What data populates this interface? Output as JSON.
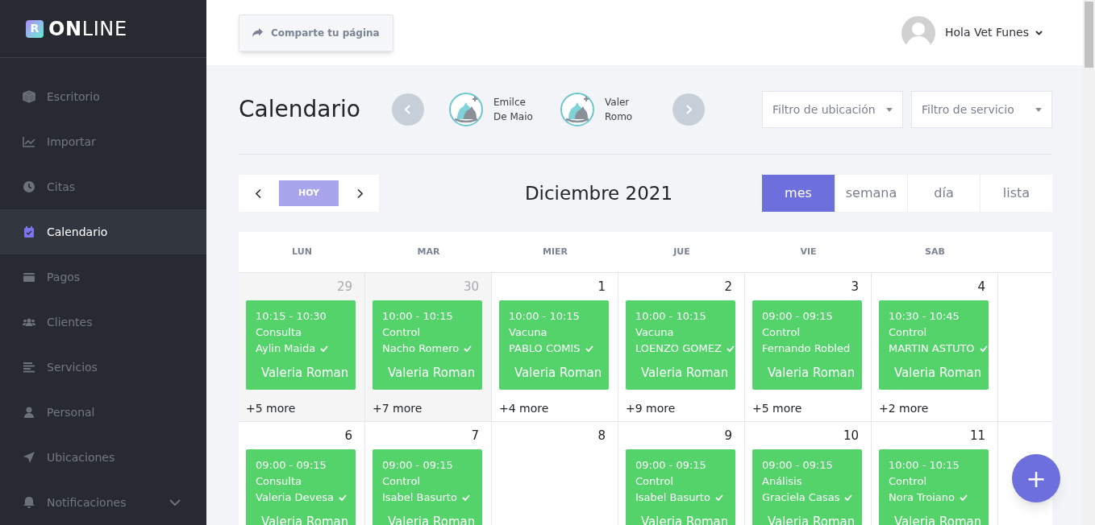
{
  "brand": {
    "mark": "R",
    "bold": "ON",
    "light": "LINE"
  },
  "sidebar": {
    "items": [
      {
        "label": "Escritorio",
        "selected": false,
        "expandable": false
      },
      {
        "label": "Importar",
        "selected": false,
        "expandable": false
      },
      {
        "label": "Citas",
        "selected": false,
        "expandable": false
      },
      {
        "label": "Calendario",
        "selected": true,
        "expandable": false
      },
      {
        "label": "Pagos",
        "selected": false,
        "expandable": false
      },
      {
        "label": "Clientes",
        "selected": false,
        "expandable": false
      },
      {
        "label": "Servicios",
        "selected": false,
        "expandable": false
      },
      {
        "label": "Personal",
        "selected": false,
        "expandable": false
      },
      {
        "label": "Ubicaciones",
        "selected": false,
        "expandable": false
      },
      {
        "label": "Notificaciones",
        "selected": false,
        "expandable": true
      }
    ]
  },
  "topbar": {
    "share_button": "Comparte tu página",
    "user": "Hola Vet Funes"
  },
  "page_title": "Calendario",
  "staff": [
    {
      "name": "Emilce De Maio"
    },
    {
      "name": "Valer Romo"
    }
  ],
  "filters": [
    {
      "placeholder": "Filtro de ubicación"
    },
    {
      "placeholder": "Filtro de servicio"
    }
  ],
  "toolbar": {
    "today": "HOY",
    "title": "Diciembre 2021",
    "views": [
      {
        "label": "mes",
        "selected": true
      },
      {
        "label": "semana",
        "selected": false
      },
      {
        "label": "día",
        "selected": false
      },
      {
        "label": "lista",
        "selected": false
      }
    ]
  },
  "calendar": {
    "weekdays": [
      "LUN",
      "MAR",
      "MIER",
      "JUE",
      "VIE",
      "SAB"
    ],
    "weeks": [
      [
        {
          "day": "29",
          "muted": true,
          "events": [
            {
              "time": "10:15 - 10:30",
              "service": "Consulta",
              "client": "Aylin Maida",
              "confirmed": true,
              "provider": "Valeria Roman"
            }
          ],
          "more": "+5 more"
        },
        {
          "day": "30",
          "muted": true,
          "events": [
            {
              "time": "10:00 - 10:15",
              "service": "Control",
              "client": "Nacho Romero",
              "confirmed": true,
              "provider": "Valeria Roman"
            }
          ],
          "more": "+7 more"
        },
        {
          "day": "1",
          "muted": false,
          "events": [
            {
              "time": "10:00 - 10:15",
              "service": "Vacuna",
              "client": "PABLO COMIS",
              "confirmed": true,
              "provider": "Valeria Roman"
            }
          ],
          "more": "+4 more"
        },
        {
          "day": "2",
          "muted": false,
          "events": [
            {
              "time": "10:00 - 10:15",
              "service": "Vacuna",
              "client": "LOENZO GOMEZ",
              "confirmed": true,
              "provider": "Valeria Roman"
            }
          ],
          "more": "+9 more"
        },
        {
          "day": "3",
          "muted": false,
          "events": [
            {
              "time": "09:00 - 09:15",
              "service": "Control",
              "client": "Fernando Robled",
              "confirmed": false,
              "provider": "Valeria Roman"
            }
          ],
          "more": "+5 more"
        },
        {
          "day": "4",
          "muted": false,
          "events": [
            {
              "time": "10:30 - 10:45",
              "service": "Control",
              "client": "MARTIN ASTUTO",
              "confirmed": true,
              "provider": "Valeria Roman"
            }
          ],
          "more": "+2 more"
        }
      ],
      [
        {
          "day": "6",
          "muted": false,
          "events": [
            {
              "time": "09:00 - 09:15",
              "service": "Consulta",
              "client": "Valeria Devesa",
              "confirmed": true,
              "provider": "Valeria Roman"
            }
          ]
        },
        {
          "day": "7",
          "muted": false,
          "events": [
            {
              "time": "09:00 - 09:15",
              "service": "Control",
              "client": "Isabel Basurto",
              "confirmed": true,
              "provider": "Valeria Roman"
            }
          ]
        },
        {
          "day": "8",
          "muted": false
        },
        {
          "day": "9",
          "muted": false,
          "events": [
            {
              "time": "09:00 - 09:15",
              "service": "Control",
              "client": "Isabel Basurto",
              "confirmed": true,
              "provider": "Valeria Roman"
            }
          ]
        },
        {
          "day": "10",
          "muted": false,
          "events": [
            {
              "time": "09:00 - 09:15",
              "service": "Análisis",
              "client": "Graciela Casas",
              "confirmed": true,
              "provider": "Valeria Roman"
            }
          ]
        },
        {
          "day": "11",
          "muted": false,
          "events": [
            {
              "time": "10:00 - 10:15",
              "service": "Control",
              "client": "Nora Troiano",
              "confirmed": true,
              "provider": "Valeria Roman"
            }
          ]
        }
      ]
    ]
  },
  "fab": "+"
}
